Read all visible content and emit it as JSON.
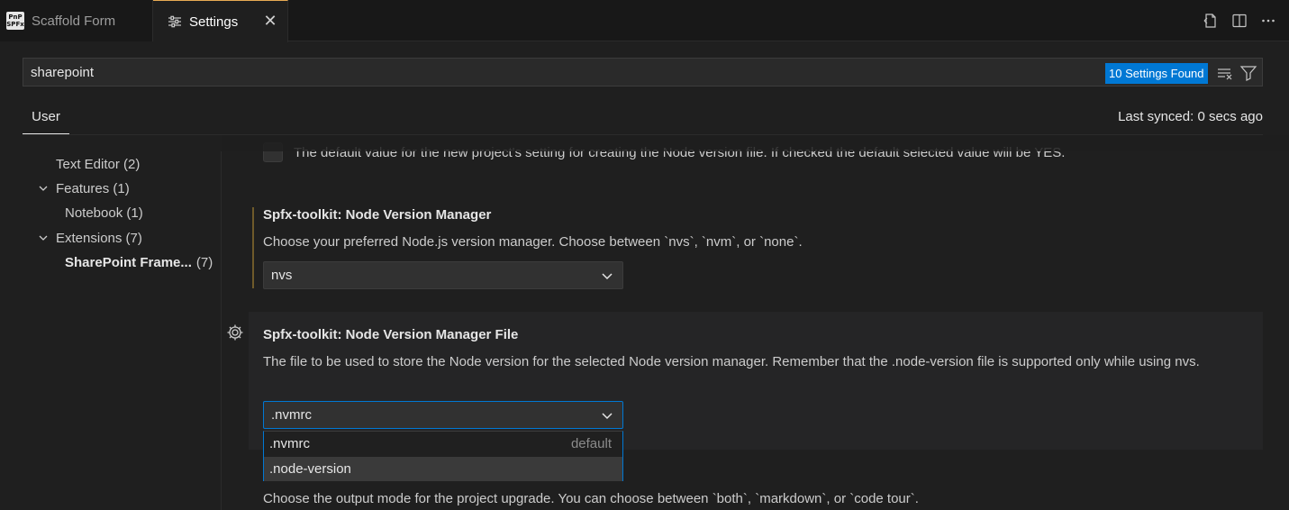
{
  "tabs": [
    {
      "label": "Scaffold Form",
      "icon": "pnp-spfx-logo",
      "logo_text": [
        "PnP",
        "SPFx"
      ],
      "active": false
    },
    {
      "label": "Settings",
      "icon": "settings-sliders-icon",
      "active": true
    }
  ],
  "tab_close": "✕",
  "search": {
    "value": "sharepoint",
    "results_badge": "10 Settings Found"
  },
  "scope": {
    "tab_label": "User",
    "last_synced": "Last synced: 0 secs ago"
  },
  "toc": [
    {
      "label": "Text Editor (2)",
      "expanded": null
    },
    {
      "label": "Features (1)",
      "expanded": true
    },
    {
      "label": "Notebook (1)",
      "expanded": null
    },
    {
      "label": "Extensions (7)",
      "expanded": true
    },
    {
      "label": "SharePoint Frame...",
      "count": "(7)",
      "selected": true
    }
  ],
  "settings": {
    "cut_text": "The default value for the new project's setting for creating the Node version file. If checked the default selected value will be YES.",
    "nvm": {
      "category": "Spfx-toolkit: ",
      "name": "Node Version Manager",
      "description": "Choose your preferred Node.js version manager. Choose between `nvs`, `nvm`, or `none`.",
      "value": "nvs"
    },
    "nvm_file": {
      "category": "Spfx-toolkit: ",
      "name": "Node Version Manager File",
      "description": "The file to be used to store the Node version for the selected Node version manager. Remember that the .node-version file is supported only while using nvs.",
      "value": ".nvmrc",
      "options": [
        {
          "label": ".nvmrc",
          "tag": "default"
        },
        {
          "label": ".node-version",
          "tag": ""
        }
      ]
    },
    "upgrade": {
      "description": "Choose the output mode for the project upgrade. You can choose between `both`, `markdown`, or `code tour`."
    }
  },
  "colors": {
    "accent": "#0078d4",
    "active_tab_border": "#e8ab53",
    "modified_bar": "#6f5a2a"
  }
}
